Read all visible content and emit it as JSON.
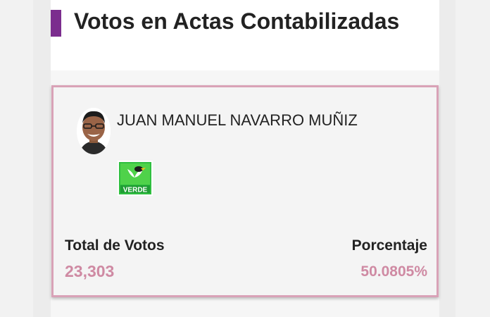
{
  "header": {
    "title": "Votos en Actas Contabilizadas",
    "accent_color": "#7b2d8e"
  },
  "candidate_card": {
    "name": "JUAN MANUEL NAVARRO MUÑIZ",
    "photo_icon": "candidate-photo",
    "party": {
      "logo_text": "VERDE",
      "logo_icon": "party-verde-logo",
      "color": "#22b24c"
    },
    "total_votes_label": "Total de Votos",
    "total_votes_value": "23,303",
    "percentage_label": "Porcentaje",
    "percentage_value": "50.0805%",
    "border_color": "#d9a2b7",
    "value_color": "#cf8aa3"
  }
}
